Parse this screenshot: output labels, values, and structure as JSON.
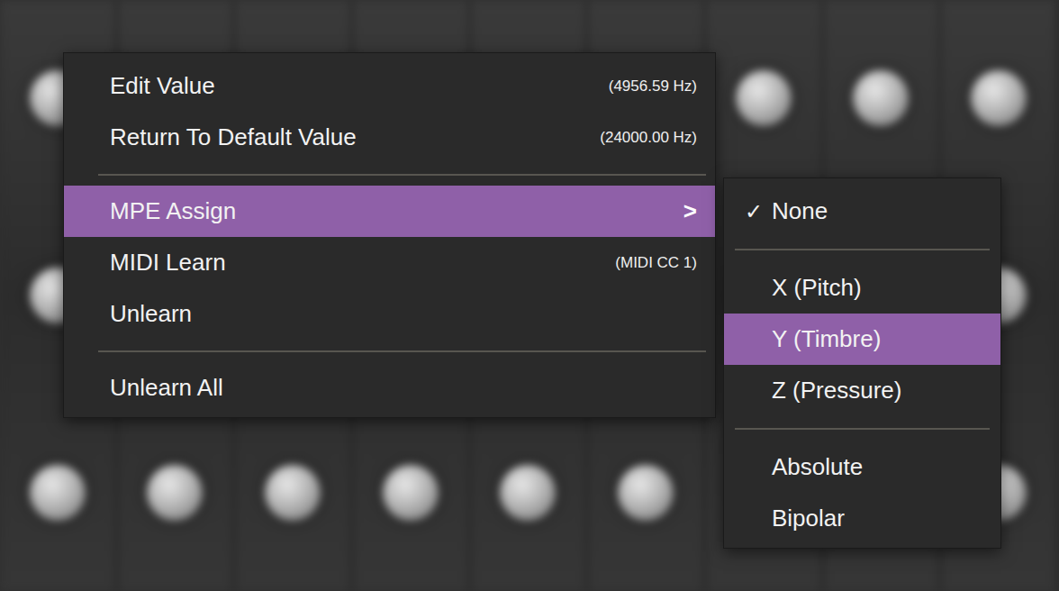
{
  "menu": {
    "items": [
      {
        "kind": "item",
        "label": "Edit Value",
        "value": "(4956.59 Hz)",
        "selected": false
      },
      {
        "kind": "item",
        "label": "Return To Default Value",
        "value": "(24000.00 Hz)",
        "selected": false
      },
      {
        "kind": "separator"
      },
      {
        "kind": "submenu",
        "label": "MPE Assign",
        "arrow": ">",
        "selected": true
      },
      {
        "kind": "item",
        "label": "MIDI Learn",
        "value": "(MIDI CC 1)",
        "selected": false
      },
      {
        "kind": "item",
        "label": "Unlearn",
        "value": "",
        "selected": false
      },
      {
        "kind": "separator"
      },
      {
        "kind": "item",
        "label": "Unlearn All",
        "value": "",
        "selected": false
      }
    ]
  },
  "submenu": {
    "check_mark": "✓",
    "items": [
      {
        "kind": "item",
        "label": "None",
        "checked": true,
        "selected": false
      },
      {
        "kind": "separator"
      },
      {
        "kind": "item",
        "label": "X (Pitch)",
        "checked": false,
        "selected": false
      },
      {
        "kind": "item",
        "label": "Y (Timbre)",
        "checked": false,
        "selected": true
      },
      {
        "kind": "item",
        "label": "Z (Pressure)",
        "checked": false,
        "selected": false
      },
      {
        "kind": "separator"
      },
      {
        "kind": "item",
        "label": "Absolute",
        "checked": false,
        "selected": false
      },
      {
        "kind": "item",
        "label": "Bipolar",
        "checked": false,
        "selected": false
      }
    ]
  }
}
